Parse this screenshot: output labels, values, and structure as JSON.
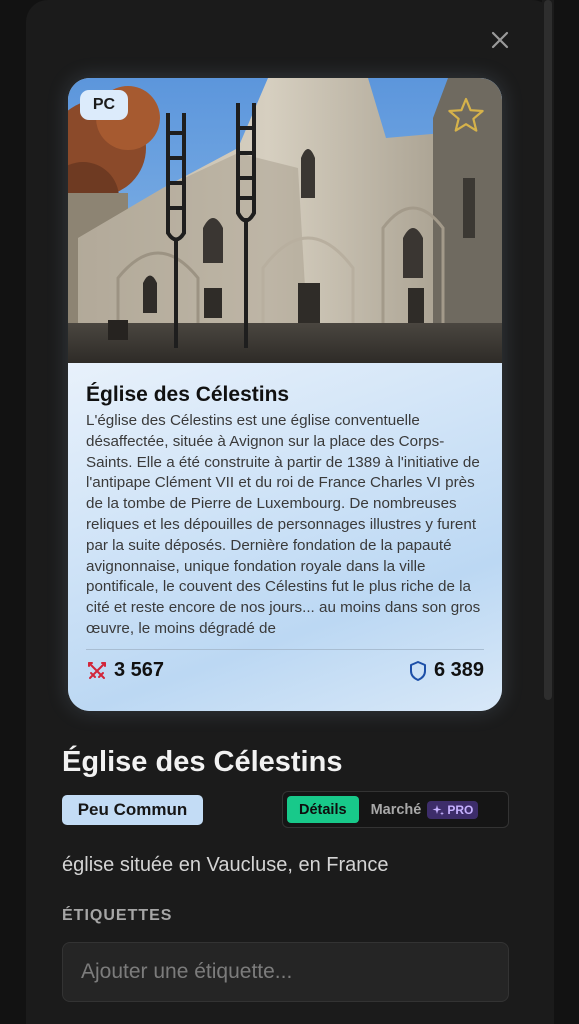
{
  "modal": {
    "close_label": "close",
    "card": {
      "platform_badge": "PC",
      "title": "Église des Célestins",
      "description": "L'église des Célestins est une église conventuelle désaffectée, située à Avignon sur la place des Corps-Saints. Elle a été construite à partir de 1389 à l'initiative de l'antipape Clément VII et du roi de France Charles VI près de la tombe de Pierre de Luxembourg. De nombreuses reliques et les dépouilles de personnages illustres y furent par la suite déposés. Dernière fondation de la papauté avignonnaise, unique fondation royale dans la ville pontificale, le couvent des Célestins fut le plus riche de la cité et reste encore de nos jours... au moins dans son gros œuvre, le moins dégradé de",
      "attack_value": "3 567",
      "defense_value": "6 389",
      "icons": {
        "attack": "crossed-swords-icon",
        "defense": "shield-icon",
        "favorite": "star-icon"
      }
    },
    "title": "Église des Célestins",
    "rarity": "Peu Commun",
    "tabs": {
      "details": "Détails",
      "market": "Marché",
      "pro": "PRO"
    },
    "subtitle": "église située en Vaucluse, en France",
    "tags_label": "ÉTIQUETTES",
    "tag_input_placeholder": "Ajouter une étiquette..."
  },
  "colors": {
    "accent_green": "#18c98a",
    "rarity_bg": "#c3dcf5",
    "pro_bg": "#3d2d6a",
    "attack_icon": "#d2263a",
    "defense_icon": "#1d4fa8"
  }
}
